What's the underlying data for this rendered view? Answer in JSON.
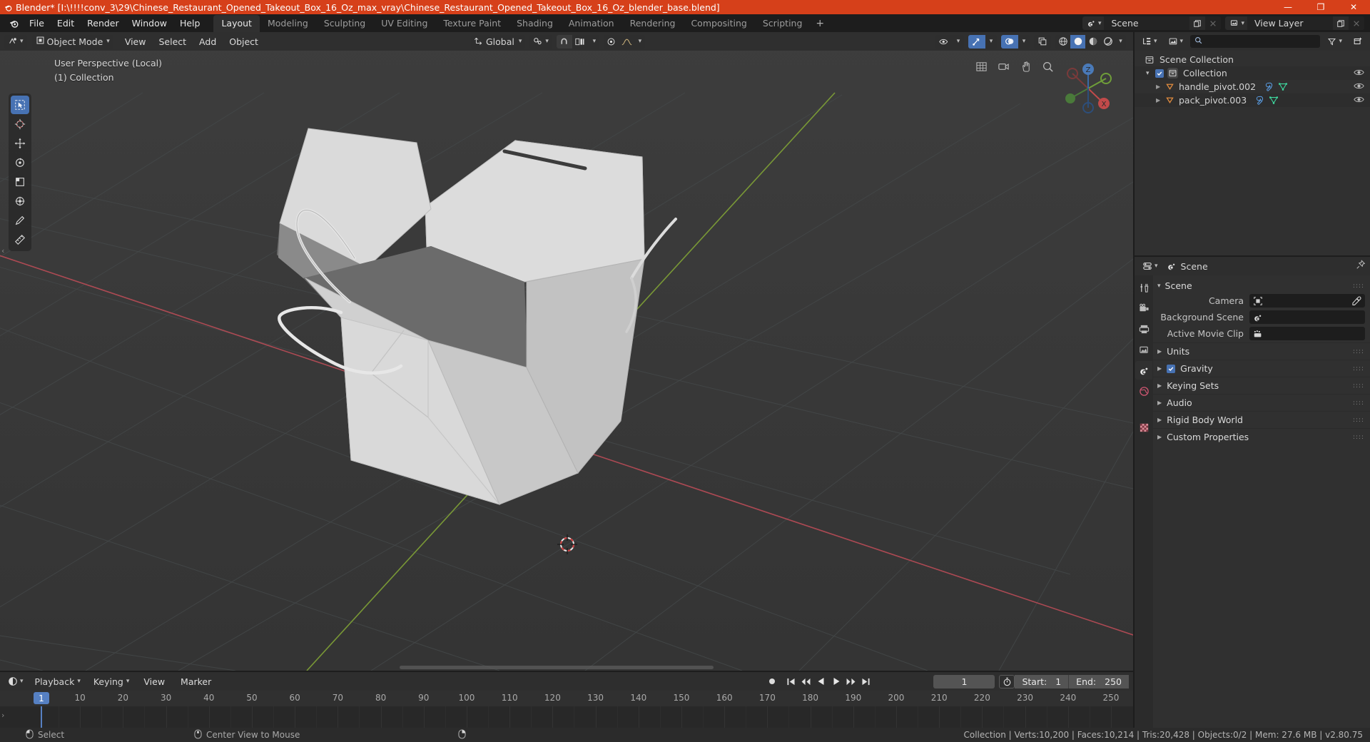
{
  "window": {
    "title": "Blender* [I:\\!!!!conv_3\\29\\Chinese_Restaurant_Opened_Takeout_Box_16_Oz_max_vray\\Chinese_Restaurant_Opened_Takeout_Box_16_Oz_blender_base.blend]",
    "minimize": "—",
    "maximize": "❐",
    "close": "✕",
    "accent": "#d6401a"
  },
  "topbar": {
    "logo_icon": "blender-logo-icon",
    "menus": [
      "File",
      "Edit",
      "Render",
      "Window",
      "Help"
    ],
    "workspaces": [
      {
        "label": "Layout",
        "active": true
      },
      {
        "label": "Modeling",
        "active": false
      },
      {
        "label": "Sculpting",
        "active": false
      },
      {
        "label": "UV Editing",
        "active": false
      },
      {
        "label": "Texture Paint",
        "active": false
      },
      {
        "label": "Shading",
        "active": false
      },
      {
        "label": "Animation",
        "active": false
      },
      {
        "label": "Rendering",
        "active": false
      },
      {
        "label": "Compositing",
        "active": false
      },
      {
        "label": "Scripting",
        "active": false
      }
    ],
    "add_workspace": "+",
    "scene": {
      "icon": "scene-icon",
      "name": "Scene",
      "new_btn": "new-scene-icon",
      "unlink_btn": "unlink-icon"
    },
    "view_layer": {
      "icon": "view-layer-icon",
      "name": "View Layer",
      "new_btn": "new-view-layer-icon",
      "unlink_btn": "unlink-icon"
    }
  },
  "viewport": {
    "header": {
      "editor_type_icon": "editor-type-3dview-icon",
      "mode": {
        "icon": "object-mode-icon",
        "label": "Object Mode"
      },
      "menus": [
        "View",
        "Select",
        "Add",
        "Object"
      ],
      "transform_orientation": {
        "icon": "orientation-icon",
        "label": "Global"
      },
      "snap_icon": "magnet-icon",
      "snap_target_icon": "snap-increment-icon",
      "proportional_icon": "proportional-edit-icon",
      "falloff_icon": "smooth-falloff-icon",
      "visibility_icon": "object-visibility-icon",
      "gizmo_icon": "gizmo-icon",
      "overlays_icon": "overlays-icon",
      "xray_icon": "xray-icon",
      "shading_modes": [
        "wireframe",
        "solid",
        "material-preview",
        "rendered"
      ],
      "shading_active": "solid"
    },
    "overlay_text": {
      "perspective": "User Perspective (Local)",
      "collection": "(1) Collection"
    },
    "tools": [
      {
        "name": "select-box-tool",
        "selected": true
      },
      {
        "name": "cursor-tool",
        "selected": false
      },
      {
        "name": "move-tool",
        "selected": false
      },
      {
        "name": "rotate-tool",
        "selected": false
      },
      {
        "name": "scale-tool",
        "selected": false
      },
      {
        "name": "transform-tool",
        "selected": false
      },
      {
        "name": "annotate-tool",
        "selected": false
      },
      {
        "name": "measure-tool",
        "selected": false
      }
    ],
    "gizmo": {
      "x": "X",
      "y": "Y",
      "z": "Z"
    },
    "nav_icons": [
      "zoom-region-icon",
      "camera-view-icon",
      "move-view-icon",
      "zoom-view-icon",
      "toggle-perspective-icon"
    ]
  },
  "outliner": {
    "display_mode_icon": "outliner-display-mode-icon",
    "filter_id_icon": "filter-id-icon",
    "search_placeholder": "",
    "search_icon": "search-icon",
    "filter_icon": "funnel-icon",
    "new_collection_icon": "new-collection-icon",
    "rows": [
      {
        "indent": 0,
        "label": "Scene Collection",
        "icon": "collection-icon",
        "has_arrow": false,
        "has_checkbox": false,
        "eye": false,
        "extra": []
      },
      {
        "indent": 1,
        "label": "Collection",
        "icon": "collection-icon",
        "has_arrow": true,
        "has_checkbox": true,
        "eye": true,
        "extra": []
      },
      {
        "indent": 2,
        "label": "handle_pivot.002",
        "icon": "empty-object-icon",
        "has_arrow": true,
        "has_checkbox": false,
        "eye": true,
        "extra": [
          "modifier-icon",
          "mesh-data-icon"
        ]
      },
      {
        "indent": 2,
        "label": "pack_pivot.003",
        "icon": "empty-object-icon",
        "has_arrow": true,
        "has_checkbox": false,
        "eye": true,
        "extra": [
          "modifier-icon",
          "mesh-data-icon"
        ]
      }
    ]
  },
  "properties": {
    "editor_icon": "properties-editor-icon",
    "breadcrumb_icon": "scene-icon",
    "breadcrumb": "Scene",
    "pin_icon": "pin-icon",
    "tabs": [
      {
        "name": "tool-tab",
        "icon": "tool-icon",
        "selected": false
      },
      {
        "name": "render-tab",
        "icon": "render-icon",
        "selected": false
      },
      {
        "name": "output-tab",
        "icon": "printer-icon",
        "selected": false
      },
      {
        "name": "view-layer-tab",
        "icon": "view-layer-icon",
        "selected": false
      },
      {
        "name": "scene-tab",
        "icon": "scene-icon",
        "selected": true
      },
      {
        "name": "world-tab",
        "icon": "world-icon",
        "selected": false
      },
      {
        "name": "texture-tab",
        "icon": "texture-icon",
        "selected": false
      }
    ],
    "panel_title": "Scene",
    "fields": [
      {
        "label": "Camera",
        "value": "",
        "icon": "camera-icon",
        "eyedropper": true
      },
      {
        "label": "Background Scene",
        "value": "",
        "icon": "scene-icon",
        "eyedropper": false
      },
      {
        "label": "Active Movie Clip",
        "value": "",
        "icon": "movie-clip-icon",
        "eyedropper": false
      }
    ],
    "sections": [
      {
        "label": "Units",
        "checkbox": false
      },
      {
        "label": "Gravity",
        "checkbox": true,
        "checked": true
      },
      {
        "label": "Keying Sets",
        "checkbox": false
      },
      {
        "label": "Audio",
        "checkbox": false
      },
      {
        "label": "Rigid Body World",
        "checkbox": false
      },
      {
        "label": "Custom Properties",
        "checkbox": false
      }
    ]
  },
  "timeline": {
    "editor_icon": "timeline-editor-icon",
    "menus": [
      {
        "label": "Playback",
        "dropdown": true
      },
      {
        "label": "Keying",
        "dropdown": true
      },
      {
        "label": "View",
        "dropdown": false
      },
      {
        "label": "Marker",
        "dropdown": false
      }
    ],
    "record_icon": "record-icon",
    "transport": [
      "jump-to-start-icon",
      "jump-prev-keyframe-icon",
      "play-reverse-icon",
      "play-icon",
      "jump-next-keyframe-icon",
      "jump-to-end-icon"
    ],
    "current_frame": "1",
    "auto_key_icon": "stopwatch-icon",
    "start_label": "Start:",
    "start_value": "1",
    "end_label": "End:",
    "end_value": "250",
    "playhead_frame": 1,
    "ruler_ticks": [
      10,
      20,
      30,
      40,
      50,
      60,
      70,
      80,
      90,
      100,
      110,
      120,
      130,
      140,
      150,
      160,
      170,
      180,
      190,
      200,
      210,
      220,
      230,
      240,
      250
    ]
  },
  "statusbar": {
    "left_items": [
      {
        "icon": "mouse-left-icon",
        "label": "Select"
      },
      {
        "icon": "mouse-middle-icon",
        "label": "Center View to Mouse"
      },
      {
        "icon": "mouse-right-icon",
        "label": ""
      }
    ],
    "stats": "Collection | Verts:10,200 | Faces:10,214 | Tris:20,428 | Objects:0/2 | Mem: 27.6 MB | v2.80.75"
  },
  "colors": {
    "accent_orange": "#d6401a",
    "blue_select": "#4772b3",
    "viewport_bg": "#393939",
    "panel_bg": "#303030",
    "header_bg": "#2e2e2e",
    "axis_x_red": "#cf4a5a",
    "axis_y_green": "#8fb33c",
    "model_light": "#d7d7d7",
    "model_dark": "#6e6e6e"
  }
}
